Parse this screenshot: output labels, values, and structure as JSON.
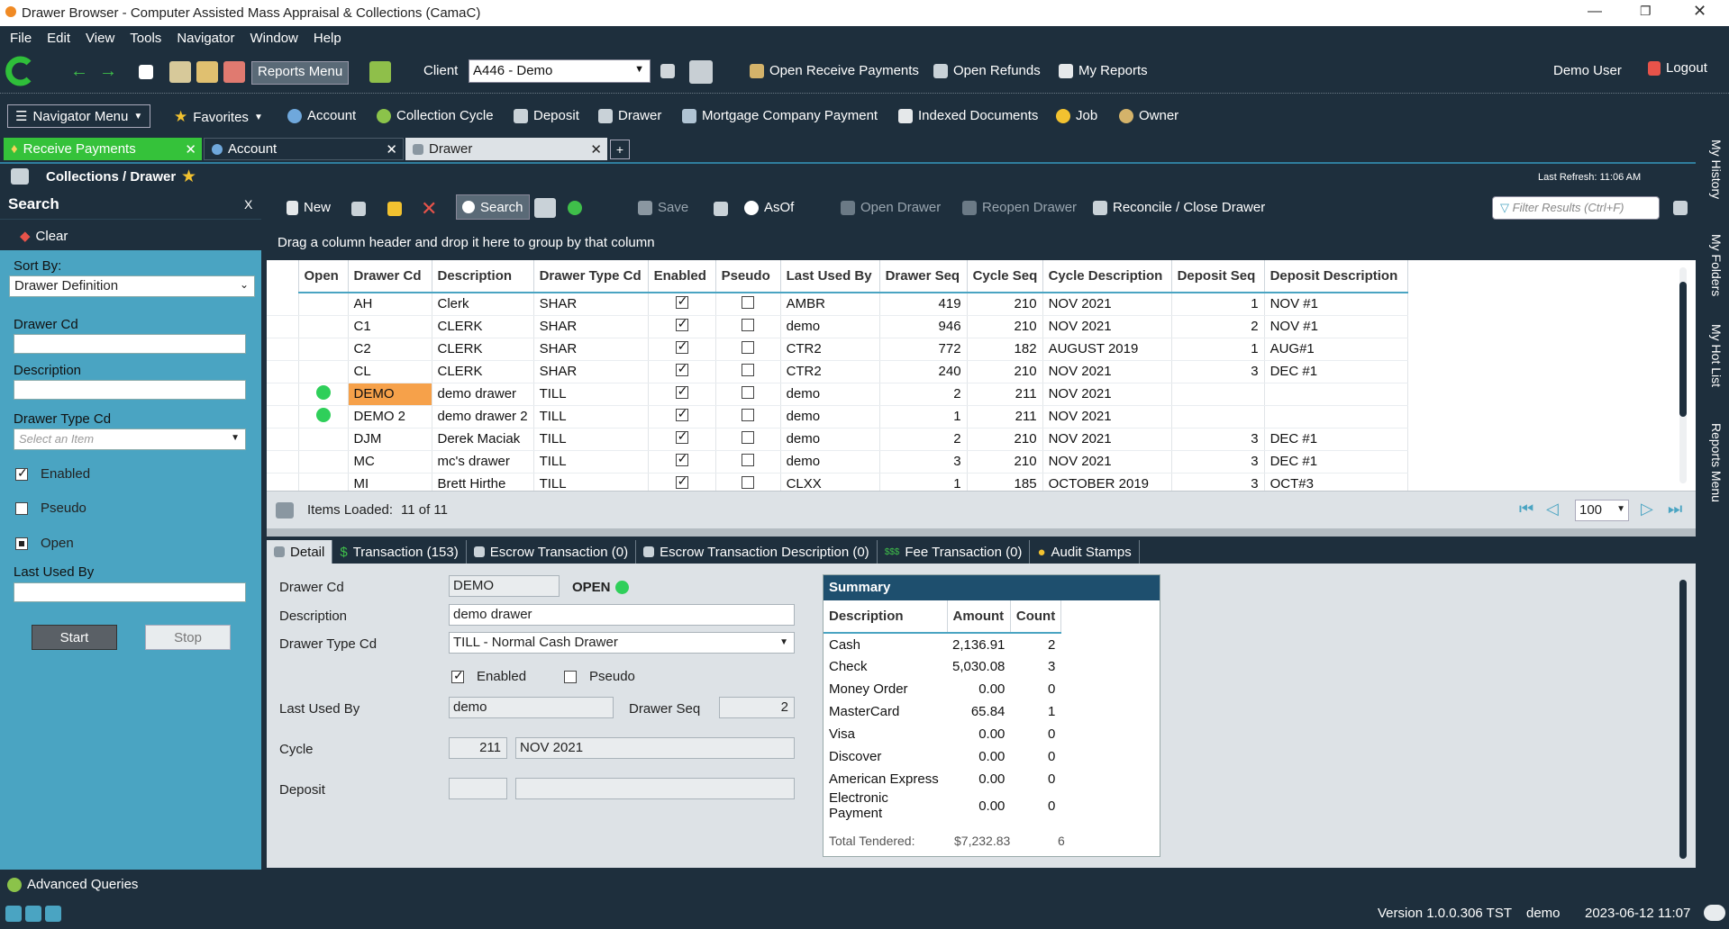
{
  "window": {
    "title": "Drawer Browser - Computer Assisted Mass Appraisal & Collections (CamaC)"
  },
  "menu": [
    "File",
    "Edit",
    "View",
    "Tools",
    "Navigator",
    "Window",
    "Help"
  ],
  "toolbar1": {
    "reports_menu": "Reports Menu",
    "client_label": "Client",
    "client_value": "A446 - Demo",
    "open_receive_payments": "Open Receive Payments",
    "open_refunds": "Open Refunds",
    "my_reports": "My Reports",
    "user": "Demo User",
    "logout": "Logout"
  },
  "toolbar2": {
    "navigator_menu": "Navigator Menu",
    "favorites": "Favorites",
    "items": [
      "Account",
      "Collection Cycle",
      "Deposit",
      "Drawer",
      "Mortgage Company Payment",
      "Indexed Documents",
      "Job",
      "Owner"
    ]
  },
  "doc_tabs": [
    "Receive Payments",
    "Account",
    "Drawer"
  ],
  "side_strip": [
    "My History",
    "My Folders",
    "My Hot List",
    "Reports Menu"
  ],
  "header": {
    "breadcrumb": "Collections / Drawer",
    "last_refresh": "Last Refresh: 11:06 AM"
  },
  "search": {
    "title": "Search",
    "close": "X",
    "clear": "Clear",
    "sort_by_label": "Sort By:",
    "sort_by_value": "Drawer Definition",
    "drawer_cd_label": "Drawer Cd",
    "description_label": "Description",
    "drawer_type_label": "Drawer Type Cd",
    "drawer_type_placeholder": "Select an Item",
    "enabled_label": "Enabled",
    "pseudo_label": "Pseudo",
    "open_label": "Open",
    "last_used_by_label": "Last Used By",
    "start": "Start",
    "stop": "Stop"
  },
  "grid_toolbar": {
    "new": "New",
    "search": "Search",
    "save": "Save",
    "asof": "AsOf",
    "open_drawer": "Open Drawer",
    "reopen_drawer": "Reopen Drawer",
    "reconcile": "Reconcile / Close Drawer",
    "filter_placeholder": "Filter Results (Ctrl+F)"
  },
  "grid": {
    "group_hint": "Drag a column header and drop it here to group by that column",
    "columns": [
      "Open",
      "Drawer Cd",
      "Description",
      "Drawer Type Cd",
      "Enabled",
      "Pseudo",
      "Last Used By",
      "Drawer Seq",
      "Cycle Seq",
      "Cycle Description",
      "Deposit Seq",
      "Deposit Description"
    ],
    "rows": [
      {
        "open": false,
        "cd": "AH",
        "desc": "Clerk",
        "type": "SHAR",
        "enabled": true,
        "pseudo": false,
        "user": "AMBR",
        "dseq": "419",
        "cseq": "210",
        "cdesc": "NOV 2021",
        "depseq": "1",
        "depdesc": "NOV #1"
      },
      {
        "open": false,
        "cd": "C1",
        "desc": "CLERK",
        "type": "SHAR",
        "enabled": true,
        "pseudo": false,
        "user": "demo",
        "dseq": "946",
        "cseq": "210",
        "cdesc": "NOV 2021",
        "depseq": "2",
        "depdesc": "NOV #1"
      },
      {
        "open": false,
        "cd": "C2",
        "desc": "CLERK",
        "type": "SHAR",
        "enabled": true,
        "pseudo": false,
        "user": "CTR2",
        "dseq": "772",
        "cseq": "182",
        "cdesc": "AUGUST 2019",
        "depseq": "1",
        "depdesc": "AUG#1"
      },
      {
        "open": false,
        "cd": "CL",
        "desc": "CLERK",
        "type": "SHAR",
        "enabled": true,
        "pseudo": false,
        "user": "CTR2",
        "dseq": "240",
        "cseq": "210",
        "cdesc": "NOV 2021",
        "depseq": "3",
        "depdesc": "DEC #1"
      },
      {
        "open": true,
        "cd": "DEMO",
        "desc": "demo drawer",
        "type": "TILL",
        "enabled": true,
        "pseudo": false,
        "user": "demo",
        "dseq": "2",
        "cseq": "211",
        "cdesc": "NOV 2021",
        "depseq": "",
        "depdesc": "",
        "selected": true
      },
      {
        "open": true,
        "cd": "DEMO 2",
        "desc": "demo drawer 2",
        "type": "TILL",
        "enabled": true,
        "pseudo": false,
        "user": "demo",
        "dseq": "1",
        "cseq": "211",
        "cdesc": "NOV 2021",
        "depseq": "",
        "depdesc": ""
      },
      {
        "open": false,
        "cd": "DJM",
        "desc": "Derek Maciak",
        "type": "TILL",
        "enabled": true,
        "pseudo": false,
        "user": "demo",
        "dseq": "2",
        "cseq": "210",
        "cdesc": "NOV 2021",
        "depseq": "3",
        "depdesc": "DEC #1"
      },
      {
        "open": false,
        "cd": "MC",
        "desc": "mc's drawer",
        "type": "TILL",
        "enabled": true,
        "pseudo": false,
        "user": "demo",
        "dseq": "3",
        "cseq": "210",
        "cdesc": "NOV 2021",
        "depseq": "3",
        "depdesc": "DEC #1"
      },
      {
        "open": false,
        "cd": "MI",
        "desc": "Brett Hirthe",
        "type": "TILL",
        "enabled": true,
        "pseudo": false,
        "user": "CLXX",
        "dseq": "1",
        "cseq": "185",
        "cdesc": "OCTOBER 2019",
        "depseq": "3",
        "depdesc": "OCT#3"
      }
    ],
    "items_loaded_label": "Items Loaded:",
    "items_loaded_value": "11 of 11",
    "page_size": "100"
  },
  "detail_tabs": [
    "Detail",
    "Transaction (153)",
    "Escrow Transaction (0)",
    "Escrow Transaction Description (0)",
    "Fee Transaction (0)",
    "Audit Stamps"
  ],
  "detail": {
    "drawer_cd_label": "Drawer Cd",
    "drawer_cd": "DEMO",
    "status": "OPEN",
    "description_label": "Description",
    "description": "demo drawer",
    "drawer_type_label": "Drawer Type Cd",
    "drawer_type": "TILL - Normal Cash Drawer",
    "enabled_label": "Enabled",
    "pseudo_label": "Pseudo",
    "last_used_by_label": "Last Used By",
    "last_used_by": "demo",
    "drawer_seq_label": "Drawer Seq",
    "drawer_seq": "2",
    "cycle_label": "Cycle",
    "cycle_seq": "211",
    "cycle_desc": "NOV 2021",
    "deposit_label": "Deposit"
  },
  "summary": {
    "title": "Summary",
    "columns": [
      "Description",
      "Amount",
      "Count"
    ],
    "rows": [
      {
        "d": "Cash",
        "a": "2,136.91",
        "c": "2"
      },
      {
        "d": "Check",
        "a": "5,030.08",
        "c": "3"
      },
      {
        "d": "Money Order",
        "a": "0.00",
        "c": "0"
      },
      {
        "d": "MasterCard",
        "a": "65.84",
        "c": "1"
      },
      {
        "d": "Visa",
        "a": "0.00",
        "c": "0"
      },
      {
        "d": "Discover",
        "a": "0.00",
        "c": "0"
      },
      {
        "d": "American Express",
        "a": "0.00",
        "c": "0"
      },
      {
        "d": "Electronic Payment",
        "a": "0.00",
        "c": "0"
      }
    ],
    "total_label": "Total Tendered:",
    "total_amount": "$7,232.83",
    "total_count": "6"
  },
  "footer": {
    "advanced_queries": "Advanced Queries",
    "version": "Version 1.0.0.306 TST",
    "user": "demo",
    "datetime": "2023-06-12  11:07"
  },
  "colors": {
    "dark": "#1e2f3d",
    "accent": "#4aa4c2",
    "tab_active": "#35c23a",
    "open_dot": "#2fcf5a",
    "selected": "#f6a14a"
  }
}
